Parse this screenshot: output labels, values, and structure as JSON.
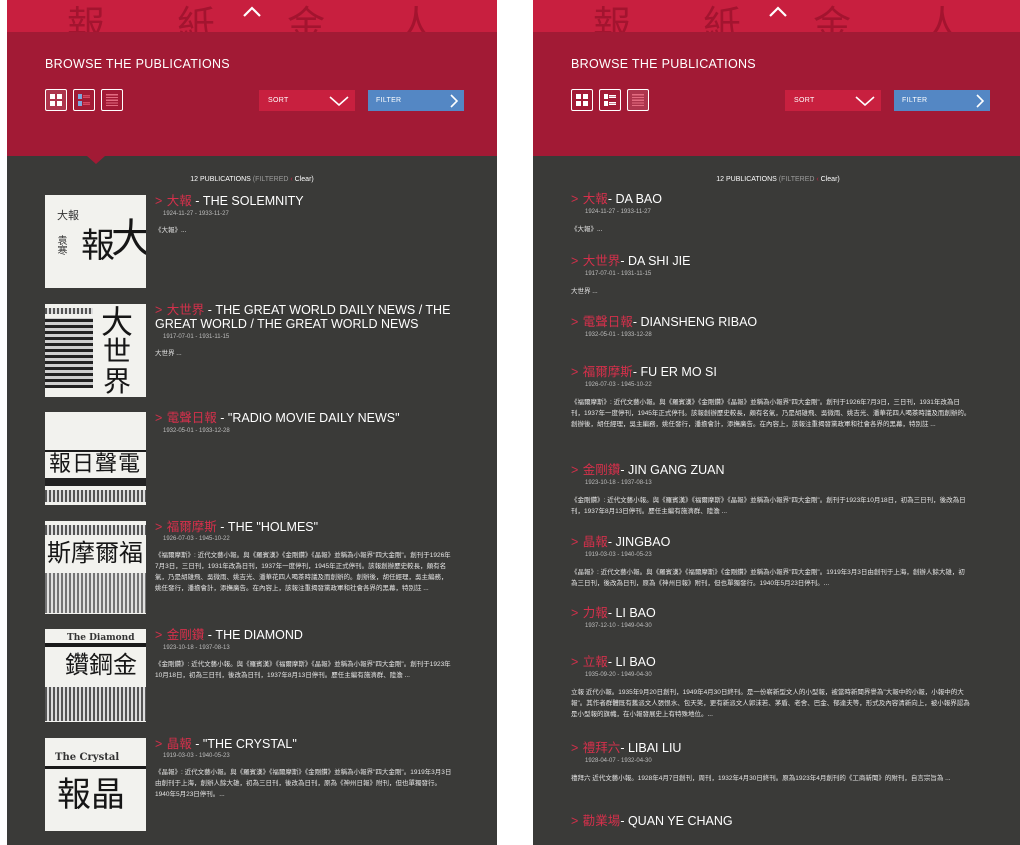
{
  "header": {
    "title": "BROWSE THE PUBLICATIONS",
    "sort_label": "SORT",
    "filter_label": "FILTER"
  },
  "count": {
    "label": "12 PUBLICATIONS",
    "filtered": "(FILTERED",
    "clear": "Clear)"
  },
  "colors": {
    "accent": "#c81f3f",
    "header_bg": "#a21a35",
    "filter_bg": "#5487c4",
    "list_bg": "#3a3a38"
  },
  "icons": [
    "chevron-up-icon",
    "grid-view-icon",
    "compact-list-view-icon",
    "list-view-icon",
    "chevron-down-icon",
    "chevron-right-icon"
  ],
  "left_list": [
    {
      "cn": "大報",
      "title": "- THE SOLEMNITY",
      "dates": "1924-11-27 - 1933-11-27",
      "desc": "《大報》..."
    },
    {
      "cn": "大世界",
      "title": "- THE GREAT WORLD DAILY NEWS / THE GREAT WORLD / THE GREAT WORLD NEWS",
      "dates": "1917-07-01 - 1931-11-15",
      "desc": "大世界 ..."
    },
    {
      "cn": "電聲日報",
      "title": "- \"RADIO MOVIE DAILY NEWS\"",
      "dates": "1932-05-01 - 1933-12-28",
      "desc": ""
    },
    {
      "cn": "福爾摩斯",
      "title": "- THE \"HOLMES\"",
      "dates": "1926-07-03 - 1945-10-22",
      "desc": "《福爾摩斯》: 近代文藝小報。與《羅賓漢》《金剛鑽》《晶報》並稱為小報界\"四大金剛\"。創刊于1926年7月3日，三日刊，1931年改為日刊，1937年一度停刊，1945年正式停刊。該報創辦歷史較長，頗有名氣，乃是胡雄飛、吳微雨、姚吉光、潘華花四人喝茶時議及而創辦的。創辦後，胡任經理，吳主編務，姚任發行，潘擔會計，添撫廣告。在內容上，該報注重揭發黨政軍和社會各界的黑幕，特別註 ..."
    },
    {
      "cn": "金剛鑽",
      "title": "- THE DIAMOND",
      "dates": "1923-10-18 - 1937-08-13",
      "desc": "《金剛鑽》: 近代文藝小報。與《羅賓漢》《福爾摩斯》《晶報》並稱為小報界\"四大金剛\"。創刊于1923年10月18日，初為三日刊，後改為日刊，1937年8月13日停刊。歷任主編有施濟群、陸澹 ..."
    },
    {
      "cn": "晶報",
      "title": "- \"THE CRYSTAL\"",
      "dates": "1919-03-03 - 1940-05-23",
      "desc": "《晶報》: 近代文藝小報。與《羅賓漢》《福爾摩斯》《金剛鑽》並稱為小報界\"四大金剛\"。1919年3月3日由創刊于上海，創辦人餘大雄，初為三日刊，後改為日刊，原為《神州日報》附刊，但也單獨發行。1940年5月23日停刊。..."
    }
  ],
  "right_list": [
    {
      "cn": "大報",
      "title": "- DA BAO",
      "dates": "1924-11-27 - 1933-11-27",
      "desc": "《大報》..."
    },
    {
      "cn": "大世界",
      "title": "- DA SHI JIE",
      "dates": "1917-07-01 - 1931-11-15",
      "desc": "大世界 ..."
    },
    {
      "cn": "電聲日報",
      "title": "- DIANSHENG RIBAO",
      "dates": "1932-05-01 - 1933-12-28",
      "desc": ""
    },
    {
      "cn": "福爾摩斯",
      "title": "- FU ER MO SI",
      "dates": "1926-07-03 - 1945-10-22",
      "desc": "《福爾摩斯》: 近代文藝小報。與《羅賓漢》《金剛鑽》《晶報》並稱為小報界\"四大金剛\"。創刊于1926年7月3日，三日刊，1931年改為日刊，1937年一度停刊，1945年正式停刊。該報創辦歷史較長，頗有名氣，乃是胡雄飛、吳微雨、姚吉光、潘華花四人喝茶時議及而創辦的。創辦後，胡任經理，吳主編務，姚任發行，潘擔會計，添撫廣告。在內容上，該報注重揭發黨政軍和社會各界的黑幕，特別註 ..."
    },
    {
      "cn": "金剛鑽",
      "title": "- JIN GANG ZUAN",
      "dates": "1923-10-18 - 1937-08-13",
      "desc": "《金剛鑽》: 近代文藝小報。與《羅賓漢》《福爾摩斯》《晶報》並稱為小報界\"四大金剛\"。創刊于1923年10月18日，初為三日刊，後改為日刊，1937年8月13日停刊。歷任主編有施濟群、陸澹 ..."
    },
    {
      "cn": "晶報",
      "title": "- JINGBAO",
      "dates": "1919-03-03 - 1940-05-23",
      "desc": "《晶報》: 近代文藝小報。與《羅賓漢》《福爾摩斯》《金剛鑽》並稱為小報界\"四大金剛\"。1919年3月3日由創刊于上海，創辦人餘大雄，初為三日刊，後改為日刊，原為《神州日報》附刊，但也單獨發行。1940年5月23日停刊。..."
    },
    {
      "cn": "力報",
      "title": "- LI BAO",
      "dates": "1937-12-10 - 1949-04-30",
      "desc": ""
    },
    {
      "cn": "立報",
      "title": "- LI BAO",
      "dates": "1935-09-20 - 1949-04-30",
      "desc": "立報 近代小報。1935年9月20日創刊，1949年4月30日終刊。是一份嶄新型文人的小型報，被當時新聞界譽為\"大報中的小報，小報中的大報\"。其作者群體既有舊派文人張恨水、包天笑，更有新派文人郭沫若、茅盾、老舍、巴金、郁達夫等，形式及內容清新向上，被小報界認為是小型報的旗幟，在小報發展史上有特殊地位。..."
    },
    {
      "cn": "禮拜六",
      "title": "- LIBAI LIU",
      "dates": "1928-04-07 - 1932-04-30",
      "desc": "禮拜六 近代文藝小報。1928年4月7日創刊，周刊，1932年4月30日終刊。原為1923年4月創刊的《工商新聞》的附刊，自言宗旨為 ..."
    },
    {
      "cn": "勸業場",
      "title": "- QUAN YE CHANG",
      "dates": "",
      "desc": ""
    }
  ]
}
